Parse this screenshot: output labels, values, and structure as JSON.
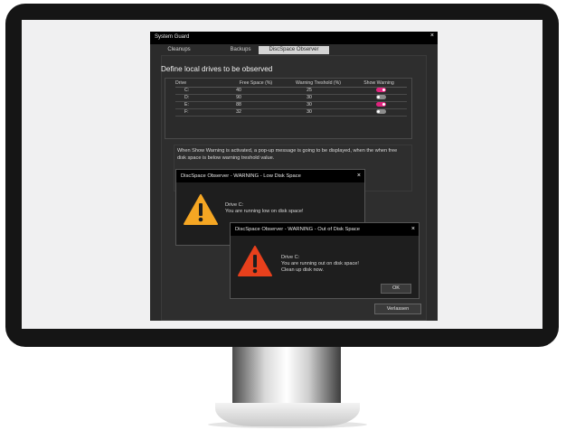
{
  "window": {
    "title": "System Guard",
    "close": "×"
  },
  "tabs": [
    {
      "label": "Cleanups",
      "active": false
    },
    {
      "label": "Backups",
      "active": false
    },
    {
      "label": "DiscSpace Observer",
      "active": true
    }
  ],
  "section": {
    "heading": "Define local drives to be observed"
  },
  "table": {
    "headers": [
      "Drive",
      "Free Space (%)",
      "Warning Treshold (%)",
      "Show Warning"
    ],
    "rows": [
      {
        "drive": "C:",
        "free": "40",
        "threshold": "25",
        "show_warning": true
      },
      {
        "drive": "D:",
        "free": "90",
        "threshold": "30",
        "show_warning": false
      },
      {
        "drive": "E:",
        "free": "88",
        "threshold": "30",
        "show_warning": true
      },
      {
        "drive": "F:",
        "free": "32",
        "threshold": "30",
        "show_warning": false
      }
    ]
  },
  "info": {
    "text": "When Show Warning is activated, a pop-up message is going to be displayed, when the when free disk space is below warning treshold value."
  },
  "exit_button": "Verlassen",
  "popup_low": {
    "title": "DiscSpace Observer - WARNING - Low Disk Space",
    "close": "×",
    "line1": "Drive C:",
    "line2": "You are running low on disk space!"
  },
  "popup_out": {
    "title": "DiscSpace Observer - WARNING - Out of Disk Space",
    "close": "×",
    "line1": "Drive C:",
    "line2": "You are running out on disk space!",
    "line3": "Clean up disk now.",
    "ok": "OK"
  },
  "colors": {
    "toggle_on": "#e0247e",
    "toggle_off": "#8c8c8c",
    "warning_low": "#f5a623",
    "warning_out": "#e8401c"
  }
}
